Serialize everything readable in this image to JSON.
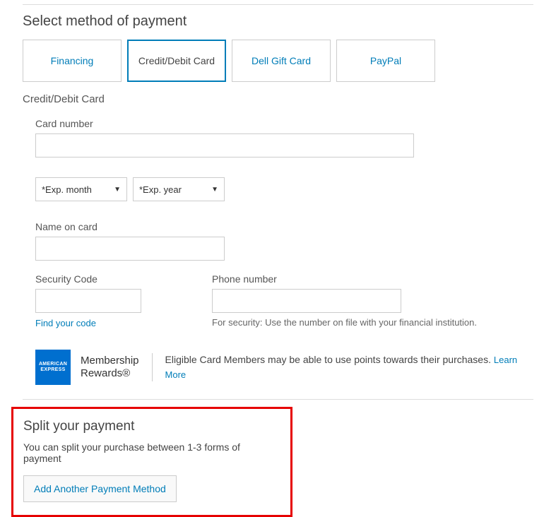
{
  "header": {
    "title": "Select method of payment"
  },
  "tabs": {
    "financing": "Financing",
    "credit": "Credit/Debit Card",
    "giftcard": "Dell Gift Card",
    "paypal": "PayPal"
  },
  "subheader": "Credit/Debit Card",
  "form": {
    "card_number_label": "Card number",
    "card_number_value": "",
    "exp_month_placeholder": "*Exp. month",
    "exp_year_placeholder": "*Exp. year",
    "name_label": "Name on card",
    "name_value": "",
    "security_label": "Security Code",
    "security_value": "",
    "find_code_link": "Find your code",
    "phone_label": "Phone number",
    "phone_value": "",
    "phone_hint": "For security: Use the number on file with your financial institution."
  },
  "amex": {
    "logo_line1": "AMERICAN",
    "logo_line2": "EXPRESS",
    "brand_line1": "Membership",
    "brand_line2": "Rewards®",
    "desc": "Eligible Card Members may be able to use points towards their purchases. ",
    "learn_more": "Learn More"
  },
  "split": {
    "title": "Split your payment",
    "desc": "You can split your purchase between 1-3 forms of payment",
    "button": "Add Another Payment Method"
  }
}
